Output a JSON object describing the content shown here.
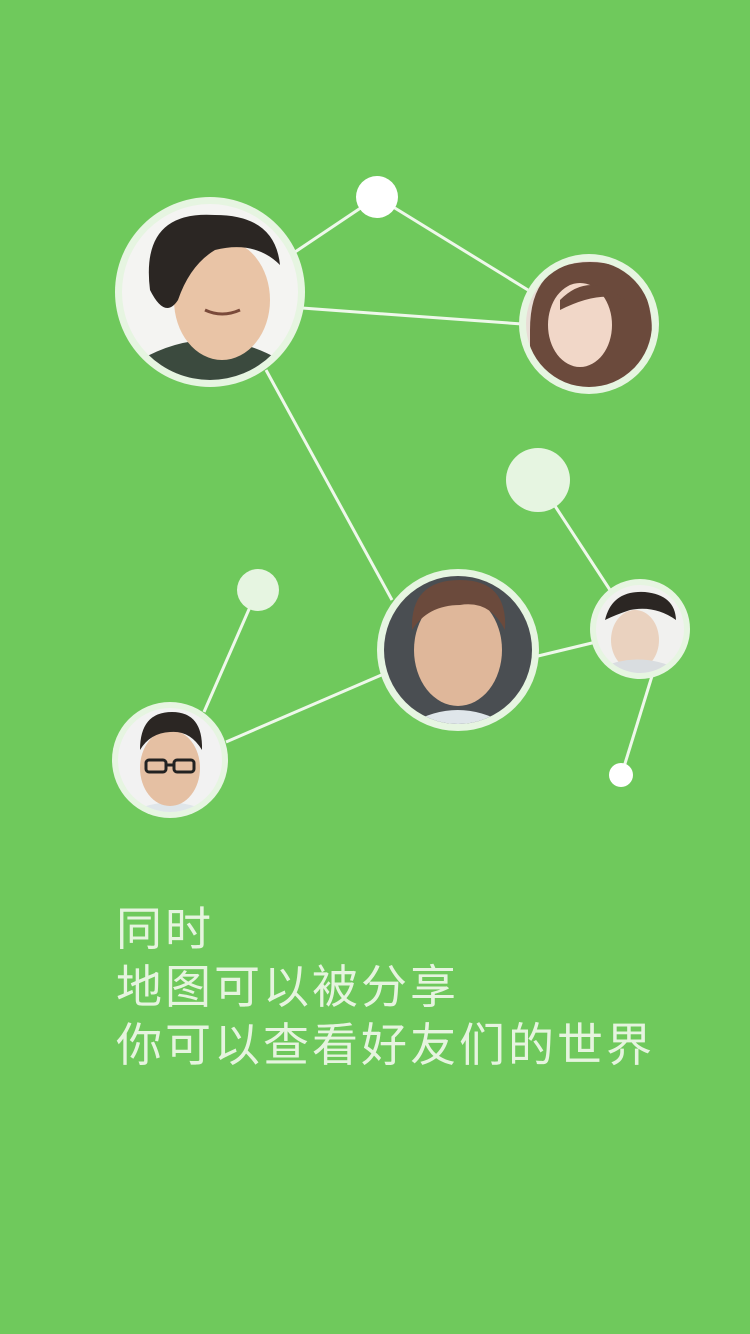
{
  "onboarding": {
    "lines": [
      "同时",
      "地图可以被分享",
      "你可以查看好友们的世界"
    ]
  },
  "colors": {
    "background": "#6fc95c",
    "ring": "#e6f5e1",
    "line": "#eef8ea",
    "text": "#e6f4df"
  }
}
